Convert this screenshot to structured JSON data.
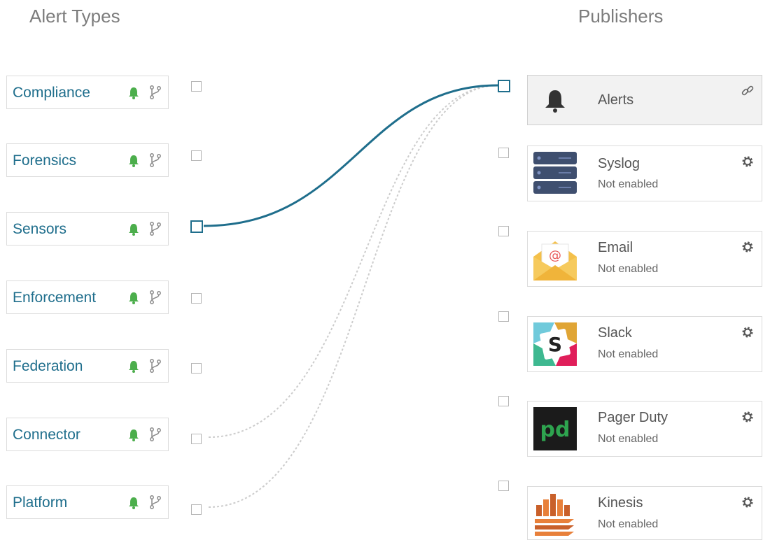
{
  "headings": {
    "alert_types": "Alert Types",
    "publishers": "Publishers"
  },
  "alert_types": [
    {
      "label": "Compliance"
    },
    {
      "label": "Forensics"
    },
    {
      "label": "Sensors"
    },
    {
      "label": "Enforcement"
    },
    {
      "label": "Federation"
    },
    {
      "label": "Connector"
    },
    {
      "label": "Platform"
    }
  ],
  "publishers": [
    {
      "title": "Alerts",
      "status": "",
      "icon": "bell-icon",
      "action_icon": "link-icon"
    },
    {
      "title": "Syslog",
      "status": "Not enabled",
      "icon": "server-icon",
      "action_icon": "gear-icon"
    },
    {
      "title": "Email",
      "status": "Not enabled",
      "icon": "email-icon",
      "action_icon": "gear-icon"
    },
    {
      "title": "Slack",
      "status": "Not enabled",
      "icon": "slack-icon",
      "action_icon": "gear-icon"
    },
    {
      "title": "Pager Duty",
      "status": "Not enabled",
      "icon": "pagerduty-icon",
      "action_icon": "gear-icon"
    },
    {
      "title": "Kinesis",
      "status": "Not enabled",
      "icon": "kinesis-icon",
      "action_icon": "gear-icon"
    }
  ],
  "connections": {
    "active": [
      {
        "from": "Sensors",
        "to": "Alerts"
      }
    ],
    "inactive": [
      {
        "from": "Connector",
        "to": "Alerts"
      },
      {
        "from": "Platform",
        "to": "Alerts"
      }
    ]
  },
  "colors": {
    "accent": "#1f6e8c",
    "bell_green": "#4cae4c",
    "muted_text": "#7c7c7c",
    "border": "#dcdcdc"
  }
}
